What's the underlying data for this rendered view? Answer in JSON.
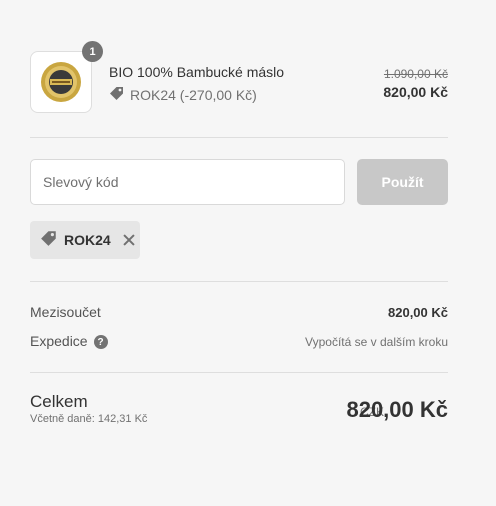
{
  "product": {
    "quantity": "1",
    "name": "BIO 100% Bambucké máslo",
    "discount_text": "ROK24 (-270,00 Kč)",
    "price_original": "1.090,00 Kč",
    "price_final": "820,00 Kč"
  },
  "discount_form": {
    "placeholder": "Slevový kód",
    "apply_label": "Použít",
    "applied_code": "ROK24"
  },
  "summary": {
    "subtotal_label": "Mezisoučet",
    "subtotal_value": "820,00 Kč",
    "shipping_label": "Expedice",
    "shipping_help": "?",
    "shipping_value": "Vypočítá se v dalším kroku"
  },
  "total": {
    "label": "Celkem",
    "tax_note": "Včetně daně: 142,31 Kč",
    "currency": "CZK",
    "amount": "820,00 Kč"
  },
  "colors": {
    "background": "#f6f6f6",
    "button_disabled": "#c8c8c8",
    "chip": "#e6e6e6",
    "badge": "#737373"
  },
  "icons": {
    "tag": "tag-icon",
    "remove": "close-icon",
    "help": "help-icon"
  }
}
